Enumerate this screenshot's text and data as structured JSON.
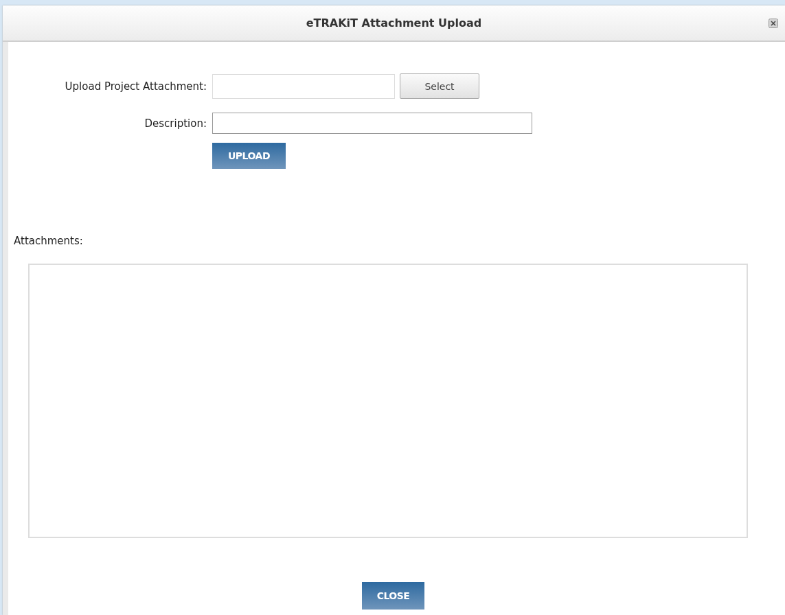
{
  "window": {
    "title": "eTRAKiT Attachment Upload"
  },
  "form": {
    "attachment_label": "Upload Project Attachment:",
    "select_button": "Select",
    "description_label": "Description:",
    "upload_button": "UPLOAD"
  },
  "attachments": {
    "label": "Attachments:"
  },
  "close_button": "CLOSE"
}
